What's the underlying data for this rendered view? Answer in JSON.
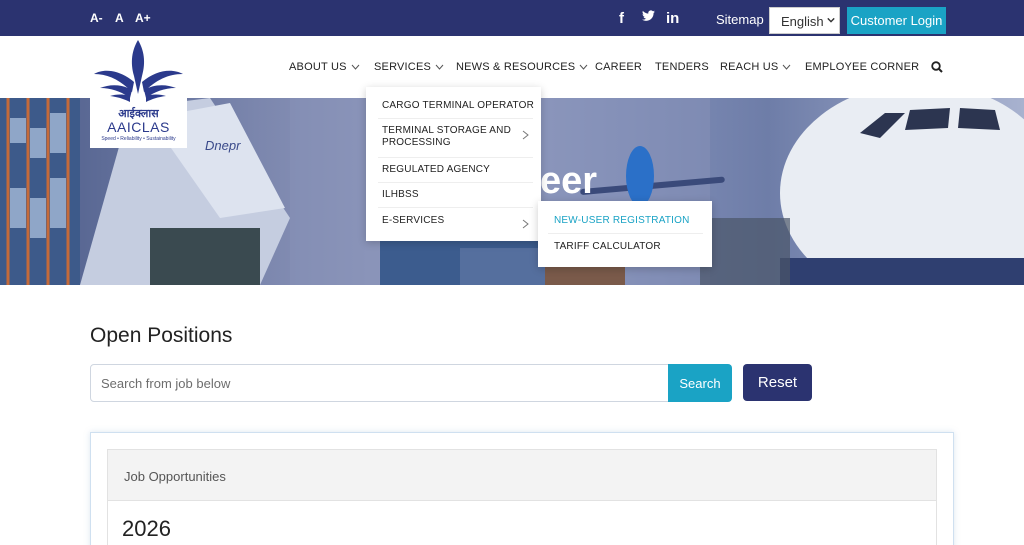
{
  "topbar": {
    "font_sizes": [
      "A-",
      "A",
      "A+"
    ],
    "social_icons": [
      "facebook-icon",
      "twitter-icon",
      "linkedin-icon"
    ],
    "social_glyphs": [
      "f",
      "t",
      "in"
    ],
    "sitemap": "Sitemap",
    "language": {
      "selected": "English"
    },
    "customer_login": "Customer Login"
  },
  "logo": {
    "hindi": "आईक्लास",
    "name": "AAICLAS",
    "tagline": "Speed • Reliability • Sustainability"
  },
  "nav": {
    "items": [
      {
        "label": "ABOUT US",
        "has_dropdown": true
      },
      {
        "label": "SERVICES",
        "has_dropdown": true
      },
      {
        "label": "NEWS & RESOURCES",
        "has_dropdown": true
      },
      {
        "label": "CAREER",
        "has_dropdown": false
      },
      {
        "label": "TENDERS",
        "has_dropdown": false
      },
      {
        "label": "REACH US",
        "has_dropdown": true
      },
      {
        "label": "EMPLOYEE CORNER",
        "has_dropdown": false
      }
    ],
    "search_icon": "search-icon"
  },
  "hero": {
    "title_visible": "eer"
  },
  "services_menu": {
    "items": [
      {
        "label": "CARGO TERMINAL OPERATOR"
      },
      {
        "label": "TERMINAL STORAGE AND PROCESSING",
        "has_submenu": true
      },
      {
        "label": "REGULATED AGENCY"
      },
      {
        "label": "ILHBSS"
      },
      {
        "label": "E-SERVICES",
        "has_submenu": true
      }
    ],
    "eservices_submenu": [
      {
        "label": "NEW-USER REGISTRATION",
        "active": true
      },
      {
        "label": "TARIFF CALCULATOR"
      }
    ]
  },
  "content": {
    "heading": "Open Positions",
    "search": {
      "placeholder": "Search from job below",
      "value": ""
    },
    "search_button": "Search",
    "reset_button": "Reset",
    "card_title": "Job Opportunities",
    "year": "2026"
  },
  "colors": {
    "navy": "#2b3370",
    "teal": "#1aa3c5",
    "active_submenu": "#1aa3c5"
  }
}
